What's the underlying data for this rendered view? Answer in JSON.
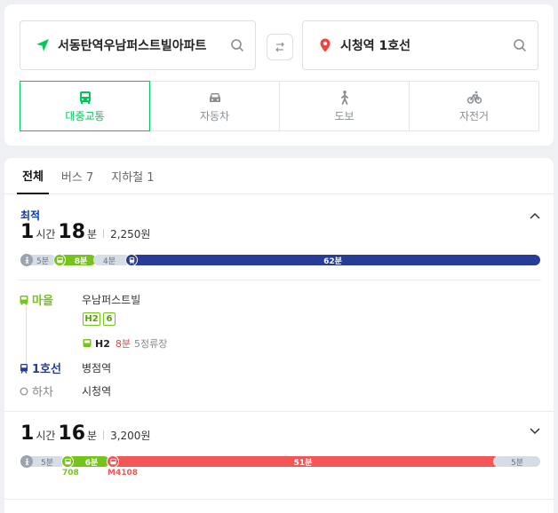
{
  "search": {
    "origin": "서동탄역우남퍼스트빌아파트",
    "destination": "시청역 1호선"
  },
  "modes": [
    {
      "label": "대중교통",
      "icon": "bus-icon",
      "active": true
    },
    {
      "label": "자동차",
      "icon": "car-icon",
      "active": false
    },
    {
      "label": "도보",
      "icon": "walk-icon",
      "active": false
    },
    {
      "label": "자전거",
      "icon": "bicycle-icon",
      "active": false
    }
  ],
  "tabs": [
    {
      "label": "전체",
      "active": true
    },
    {
      "label": "버스 7",
      "active": false
    },
    {
      "label": "지하철 1",
      "active": false
    }
  ],
  "routes": [
    {
      "badge": "최적",
      "hours": "1",
      "hours_unit": "시간",
      "minutes": "18",
      "minutes_unit": "분",
      "fare": "2,250원",
      "expanded": true,
      "segments": [
        {
          "type": "walk",
          "minutes": 5,
          "label": "5분"
        },
        {
          "type": "bus",
          "minutes": 8,
          "label": "8분",
          "color": "#75c41b"
        },
        {
          "type": "walk",
          "minutes": 4,
          "label": "4분"
        },
        {
          "type": "subway",
          "minutes": 62,
          "label": "62분",
          "color": "#263c96"
        }
      ],
      "steps": {
        "step1_label": "마을",
        "step1_name": "우남퍼스트빌",
        "chips": [
          "H2",
          "6"
        ],
        "bus_no": "H2",
        "bus_wait": "8분",
        "bus_stops": "5정류장",
        "step2_label": "1호선",
        "step2_name": "병점역",
        "step3_label": "하차",
        "step3_name": "시청역"
      }
    },
    {
      "hours": "1",
      "hours_unit": "시간",
      "minutes": "16",
      "minutes_unit": "분",
      "fare": "3,200원",
      "expanded": false,
      "segments": [
        {
          "type": "walk",
          "minutes": 5,
          "label": "5분"
        },
        {
          "type": "bus",
          "minutes": 6,
          "label": "6분",
          "color": "#75c41b",
          "line": "708"
        },
        {
          "type": "bus",
          "minutes": 51,
          "label": "51분",
          "color": "#f25656",
          "line": "M4108"
        },
        {
          "type": "walk",
          "minutes": 5,
          "label": "5분"
        }
      ]
    }
  ],
  "colors": {
    "accent": "#03c75a",
    "town_bus": "#75c41b",
    "line1": "#263c96",
    "red_bus": "#f25656"
  }
}
